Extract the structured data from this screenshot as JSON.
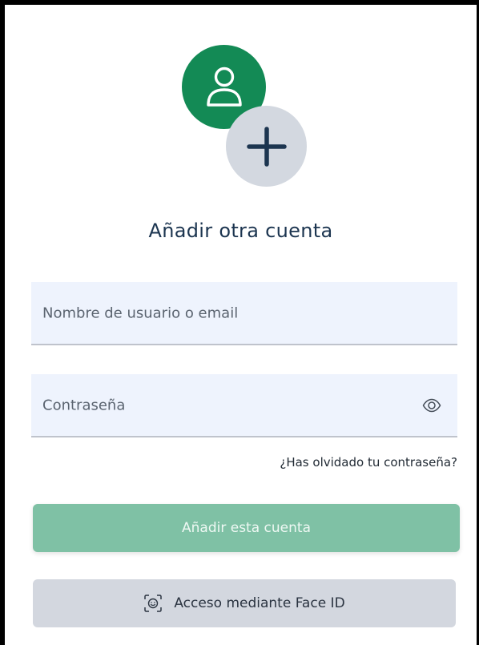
{
  "header": {
    "title": "Añadir otra cuenta",
    "avatar_icon": "user-icon",
    "add_icon": "plus-icon"
  },
  "form": {
    "username_placeholder": "Nombre de usuario o email",
    "username_value": "",
    "password_placeholder": "Contraseña",
    "password_value": "",
    "show_password_icon": "eye-icon",
    "forgot_password": "¿Has olvidado tu contraseña?"
  },
  "actions": {
    "add_account_label": "Añadir esta cuenta",
    "face_id_label": "Acceso mediante Face ID",
    "face_id_icon": "face-id-icon"
  },
  "colors": {
    "avatar_bg": "#138a55",
    "plus_bg": "#d3d8e0",
    "title": "#1c3550",
    "input_bg": "#eef3fd",
    "primary_button": "#7fc1a5",
    "secondary_button": "#d3d7df"
  }
}
